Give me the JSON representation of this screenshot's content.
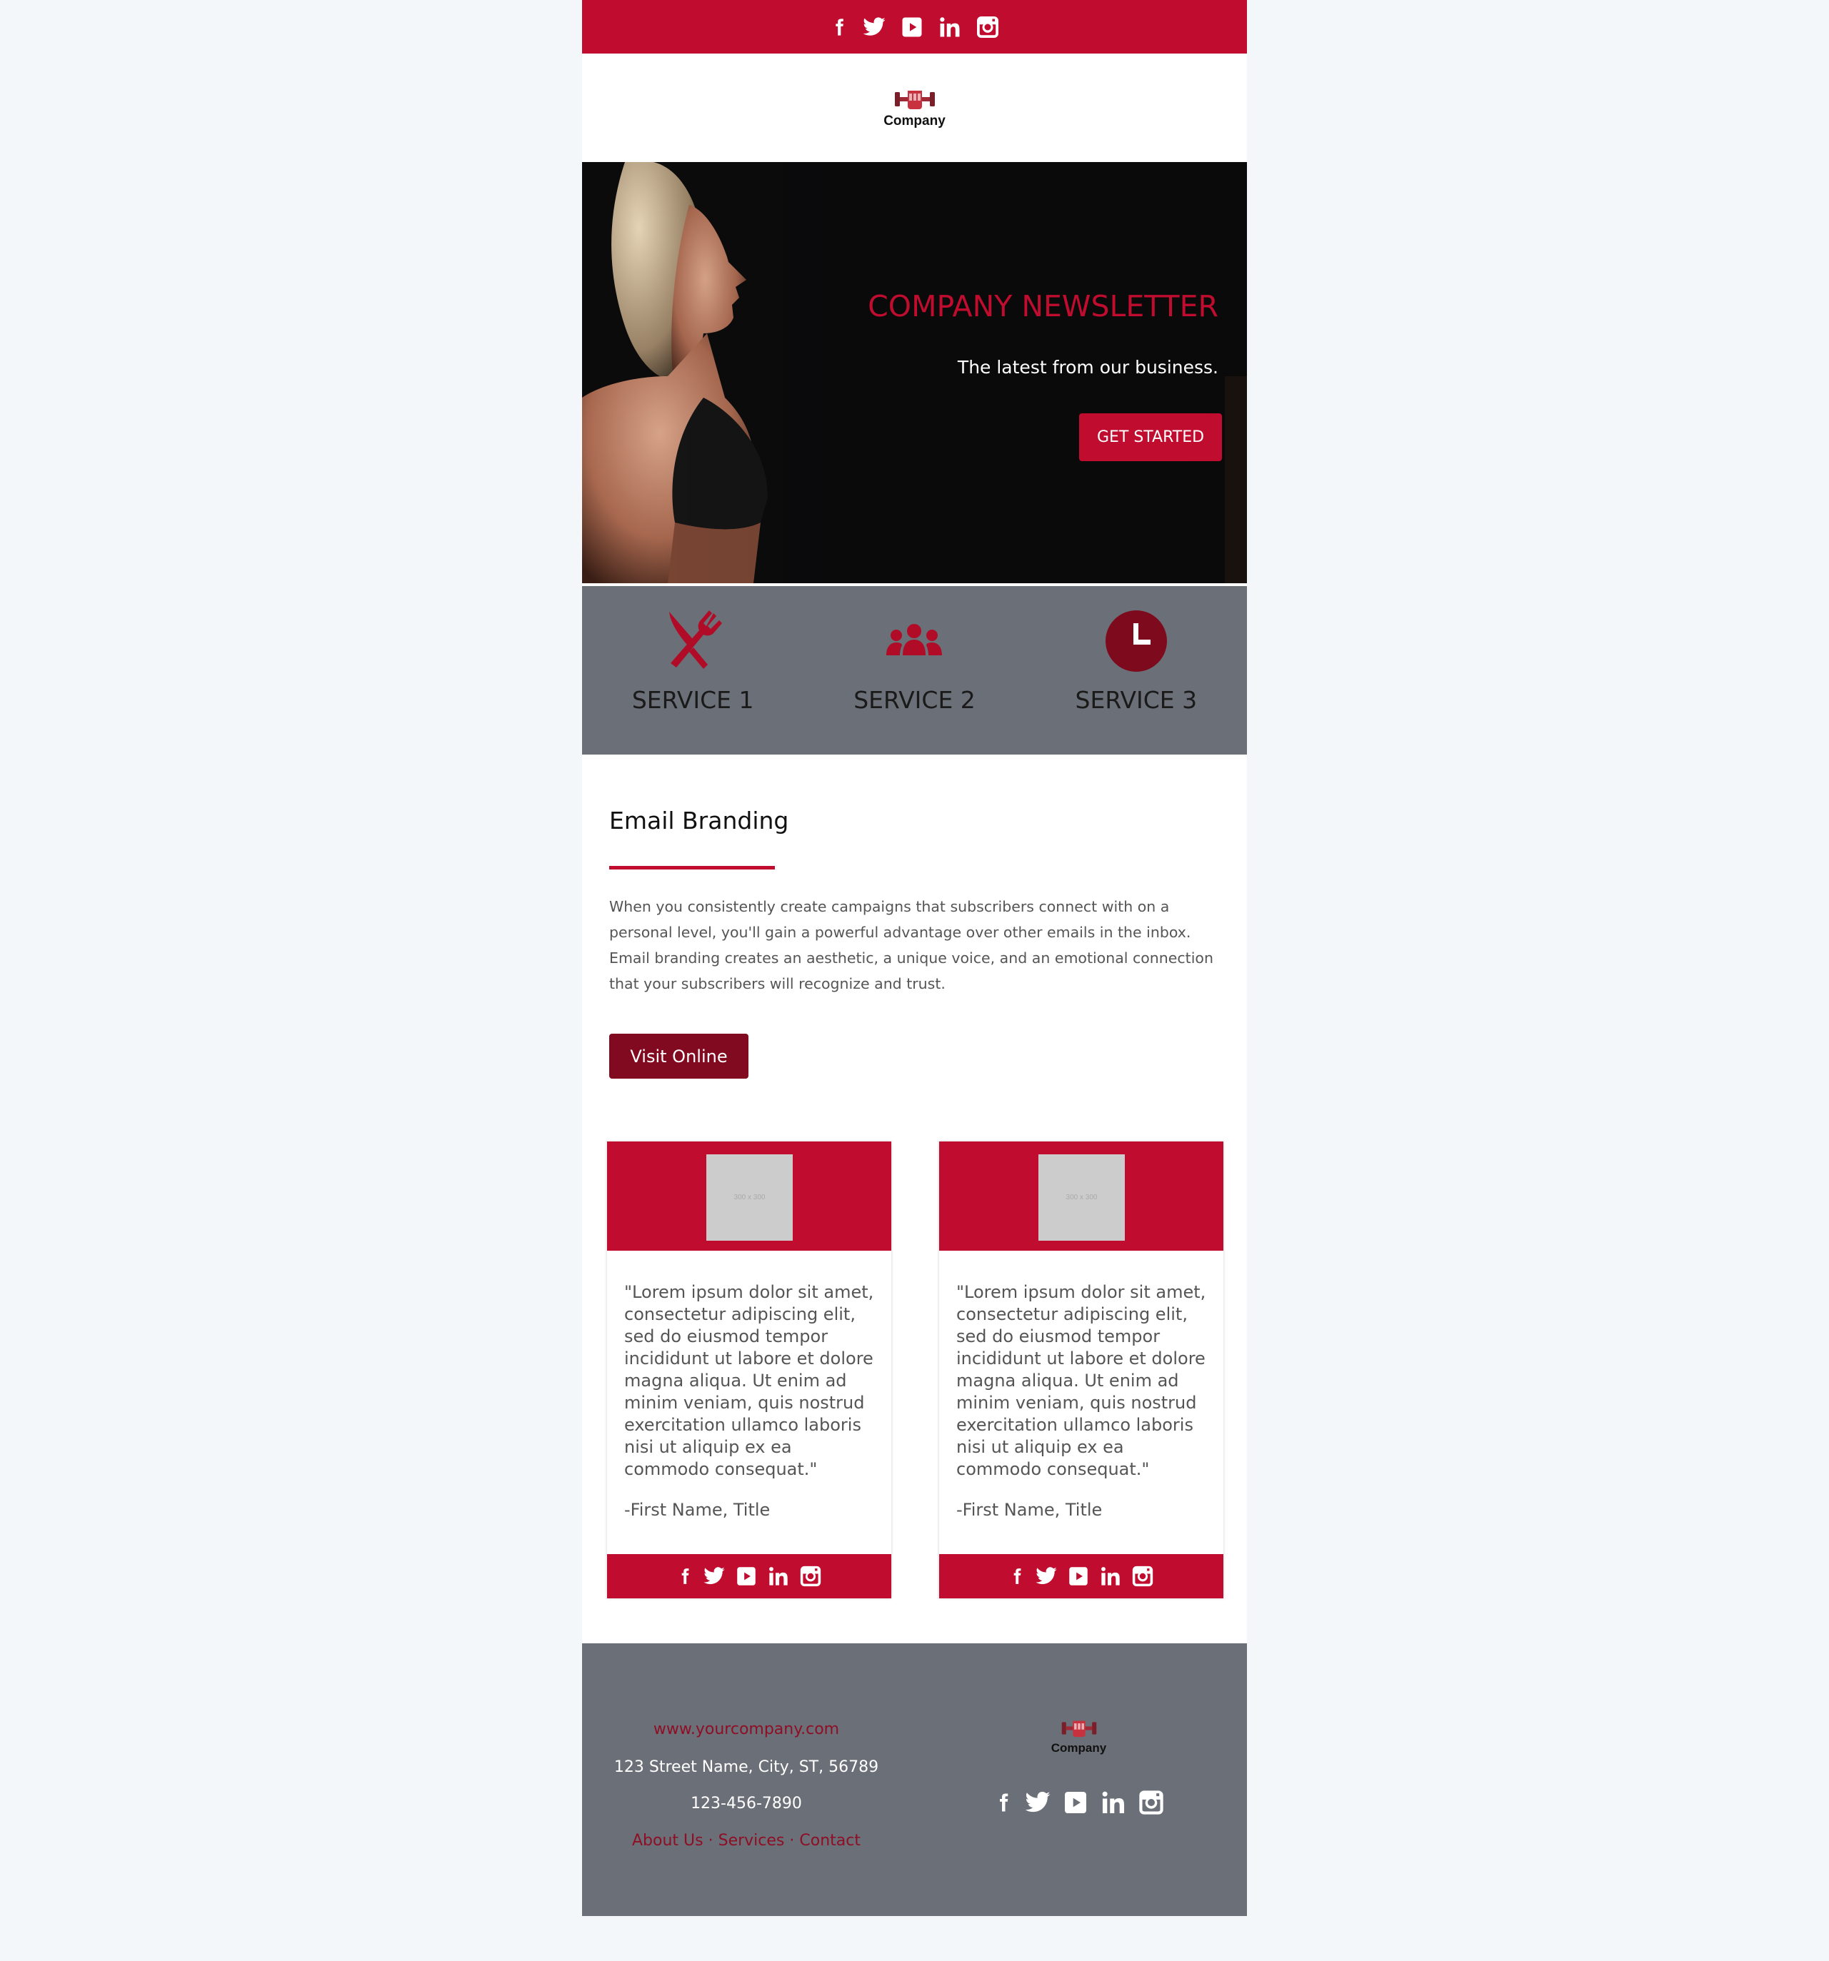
{
  "header": {
    "social": [
      "facebook-icon",
      "twitter-icon",
      "youtube-icon",
      "linkedin-icon",
      "instagram-icon"
    ],
    "logo_text": "Company"
  },
  "hero": {
    "title": "COMPANY NEWSLETTER",
    "subtitle": "The latest from our business.",
    "cta_label": "GET STARTED"
  },
  "services": [
    {
      "label": "SERVICE 1",
      "icon": "fork-knife-icon"
    },
    {
      "label": "SERVICE 2",
      "icon": "people-icon"
    },
    {
      "label": "SERVICE 3",
      "icon": "clock-icon"
    }
  ],
  "content": {
    "title": "Email Branding",
    "body": "When you consistently create campaigns that subscribers connect with on a personal level, you'll gain a powerful advantage over other emails in the inbox. Email branding creates an aesthetic, a unique voice, and an emotional connection that your subscribers will recognize and trust.",
    "button_label": "Visit Online"
  },
  "testimonials": [
    {
      "placeholder": "300 x 300",
      "quote": "\"Lorem ipsum dolor sit amet, consectetur adipiscing elit, sed do eiusmod tempor incididunt ut labore et dolore magna aliqua. Ut enim ad minim veniam, quis nostrud exercitation ullamco laboris nisi ut aliquip ex ea commodo consequat.\"",
      "author": "-First Name, Title"
    },
    {
      "placeholder": "300 x 300",
      "quote": "\"Lorem ipsum dolor sit amet, consectetur adipiscing elit, sed do eiusmod tempor incididunt ut labore et dolore magna aliqua. Ut enim ad minim veniam, quis nostrud exercitation ullamco laboris nisi ut aliquip ex ea commodo consequat.\"",
      "author": "-First Name, Title"
    }
  ],
  "footer": {
    "website": "www.yourcompany.com",
    "address": "123 Street Name, City, ST, 56789",
    "phone": "123-456-7890",
    "links": [
      "About Us",
      "Services",
      "Contact"
    ],
    "separator": "·",
    "logo_text": "Company"
  },
  "colors": {
    "brand_red": "#c00c2e",
    "dark_red": "#820a20",
    "gray_band": "#6b6f77",
    "page_bg": "#f4f7fa"
  }
}
